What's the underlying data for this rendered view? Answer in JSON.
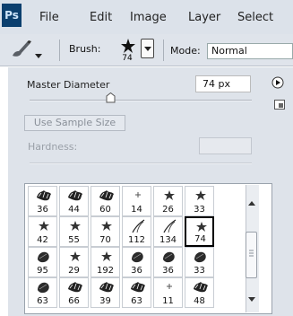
{
  "app": {
    "logo": "Ps"
  },
  "menubar": {
    "items": [
      "File",
      "Edit",
      "Image",
      "Layer",
      "Select"
    ]
  },
  "options": {
    "brush_label": "Brush:",
    "brush_size": "74",
    "mode_label": "Mode:",
    "mode_value": "Normal"
  },
  "panel": {
    "master_diameter_label": "Master Diameter",
    "master_diameter_value": "74 px",
    "use_sample_size_label": "Use Sample Size",
    "hardness_label": "Hardness:"
  },
  "presets": {
    "items": [
      {
        "size": "36",
        "shape": "grass"
      },
      {
        "size": "44",
        "shape": "grass"
      },
      {
        "size": "60",
        "shape": "grass"
      },
      {
        "size": "14",
        "shape": "dot"
      },
      {
        "size": "26",
        "shape": "star"
      },
      {
        "size": "33",
        "shape": "star"
      },
      {
        "size": "42",
        "shape": "star"
      },
      {
        "size": "55",
        "shape": "star"
      },
      {
        "size": "70",
        "shape": "star"
      },
      {
        "size": "112",
        "shape": "grass-blade"
      },
      {
        "size": "134",
        "shape": "grass-blade"
      },
      {
        "size": "74",
        "shape": "star"
      },
      {
        "size": "95",
        "shape": "leaf"
      },
      {
        "size": "29",
        "shape": "star"
      },
      {
        "size": "192",
        "shape": "star"
      },
      {
        "size": "36",
        "shape": "leaf"
      },
      {
        "size": "36",
        "shape": "leaf"
      },
      {
        "size": "33",
        "shape": "leaf"
      },
      {
        "size": "63",
        "shape": "leaf"
      },
      {
        "size": "66",
        "shape": "grass"
      },
      {
        "size": "39",
        "shape": "grass"
      },
      {
        "size": "63",
        "shape": "grass"
      },
      {
        "size": "11",
        "shape": "dot"
      },
      {
        "size": "48",
        "shape": "grass"
      }
    ],
    "selected_index": 11
  }
}
